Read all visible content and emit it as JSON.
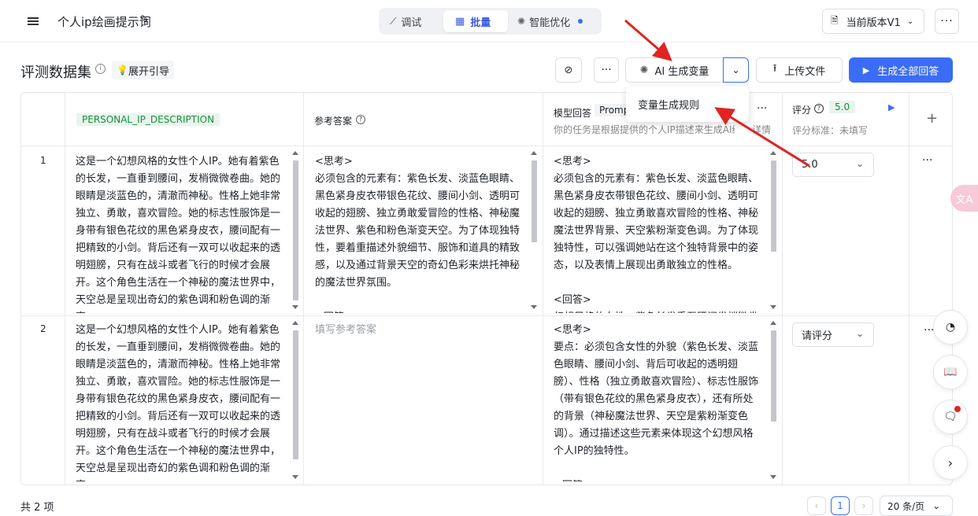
{
  "header": {
    "title": "个人ip绘画提示词",
    "tabs": [
      {
        "label": "调试"
      },
      {
        "label": "批量"
      },
      {
        "label": "智能优化"
      }
    ],
    "version_label": "当前版本V1"
  },
  "toolbar": {
    "section_title": "评测数据集",
    "guide_label": "展开引导",
    "ai_generate_label": "AI 生成变量",
    "upload_label": "上传文件",
    "generate_all_label": "生成全部回答",
    "dropdown_item": "变量生成规则"
  },
  "table": {
    "columns": {
      "variable_tag": "PERSONAL_IP_DESCRIPTION",
      "reference": "参考答案",
      "model_answer": "模型回答",
      "model_tag": "Promp",
      "model_desc": "你的任务是根据提供的个人IP描述来生成AI绘...",
      "model_detail": "详情",
      "score": "评分",
      "score_value": "5.0",
      "score_standard": "评分标准：未填写",
      "add": "+"
    },
    "rows": [
      {
        "index": "1",
        "description": "这是一个幻想风格的女性个人IP。她有着紫色的长发，一直垂到腰间，发梢微微卷曲。她的眼睛是淡蓝色的，清澈而神秘。性格上她非常独立、勇敢，喜欢冒险。她的标志性服饰是一身带有银色花纹的黑色紧身皮衣，腰间配有一把精致的小剑。背后还有一双可以收起来的透明翅膀，只有在战斗或者飞行的时候才会展开。这个角色生活在一个神秘的魔法世界中，天空总是呈现出奇幻的紫色调和粉色调的渐变。",
        "reference": "<思考>\n必须包含的元素有：紫色长发、淡蓝色眼睛、黑色紧身皮衣带银色花纹、腰间小剑、透明可收起的翅膀、独立勇敢爱冒险的性格、神秘魔法世界、紫色和粉色渐变天空。为了体现独特性，要着重描述外貌细节、服饰和道具的精致感，以及通过背景天空的奇幻色彩来烘托神秘的魔法世界氛围。\n\n<回答>",
        "reference_placeholder": "",
        "answer": "<思考>\n必须包含的元素有：紫色长发、淡蓝色眼睛、黑色紧身皮衣带银色花纹、腰间小剑、透明可收起的翅膀、独立勇敢喜欢冒险的性格、神秘魔法世界背景、天空紫粉渐变色调。为了体现独特性，可以强调她站在这个独特背景中的姿态，以及表情上展现出勇敢独立的性格。\n\n<回答>\n幻想风格的女性，紫色长发垂至腰间发梢微卷",
        "score_select": "5.0"
      },
      {
        "index": "2",
        "description": "这是一个幻想风格的女性个人IP。她有着紫色的长发，一直垂到腰间，发梢微微卷曲。她的眼睛是淡蓝色的，清澈而神秘。性格上她非常独立、勇敢，喜欢冒险。她的标志性服饰是一身带有银色花纹的黑色紧身皮衣，腰间配有一把精致的小剑。背后还有一双可以收起来的透明翅膀，只有在战斗或者飞行的时候才会展开。这个角色生活在一个神秘的魔法世界中，天空总是呈现出奇幻的紫色调和粉色调的渐变。",
        "reference": "",
        "reference_placeholder": "填写参考答案",
        "answer": "<思考>\n要点：必须包含女性的外貌（紫色长发、淡蓝色眼睛、腰间小剑、背后可收起的透明翅膀）、性格（独立勇敢喜欢冒险）、标志性服饰（带有银色花纹的黑色紧身皮衣），还有所处的背景（神秘魔法世界、天空是紫粉渐变色调）。通过描述这些元素来体现这个幻想风格个人IP的独特性。\n\n<回答>",
        "score_select": "请评分"
      }
    ]
  },
  "footer": {
    "total": "共 2 项",
    "page": "1",
    "page_size": "20 条/页"
  },
  "colors": {
    "primary": "#3b6cf6",
    "accent_green": "#1a8f3c",
    "arrow_red": "#e02424"
  }
}
